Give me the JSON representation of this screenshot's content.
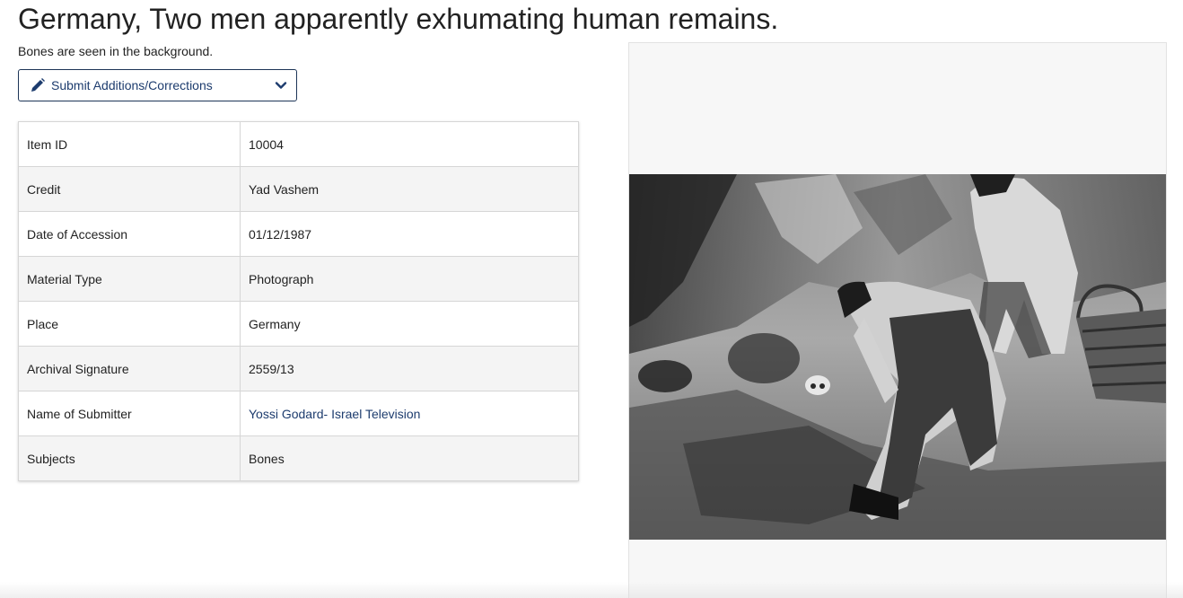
{
  "header": {
    "title": "Germany, Two men apparently exhumating human remains.",
    "subtitle": "Bones are seen in the background."
  },
  "actions": {
    "submit_label": "Submit Additions/Corrections",
    "submit_icon": "pencil-icon",
    "dropdown_icon": "chevron-down-icon"
  },
  "details": {
    "rows": [
      {
        "label": "Item ID",
        "value": "10004"
      },
      {
        "label": "Credit",
        "value": "Yad Vashem"
      },
      {
        "label": "Date of Accession",
        "value": "01/12/1987"
      },
      {
        "label": "Material Type",
        "value": "Photograph"
      },
      {
        "label": "Place",
        "value": "Germany"
      },
      {
        "label": "Archival Signature",
        "value": "2559/13"
      },
      {
        "label": "Name of Submitter",
        "value": "Yossi Godard- Israel Television"
      },
      {
        "label": "Subjects",
        "value": "Bones"
      }
    ]
  },
  "colors": {
    "link": "#1d3c6e",
    "button_border": "#1d3557"
  }
}
